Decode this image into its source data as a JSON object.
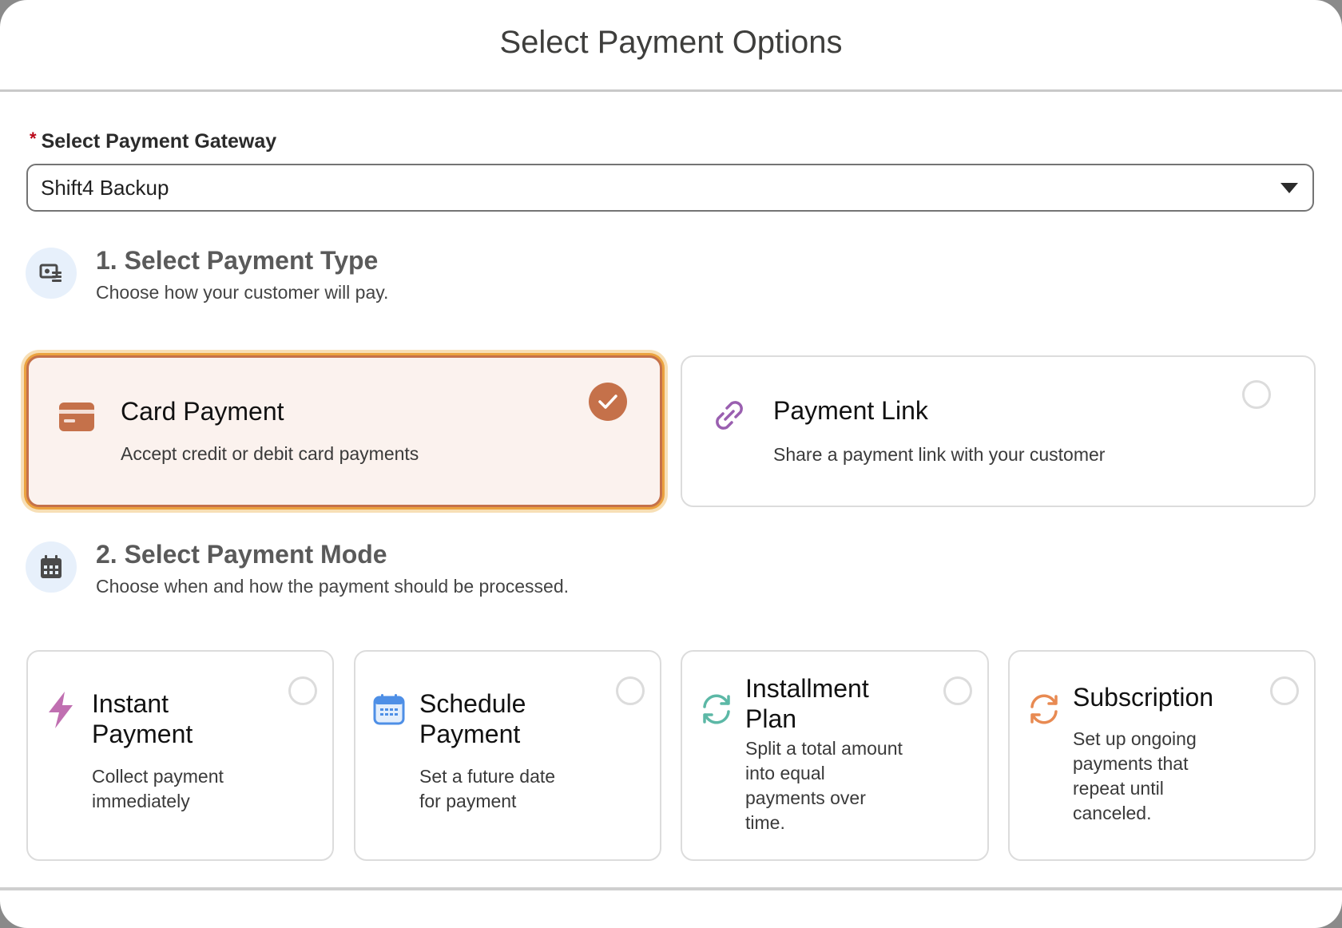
{
  "modal": {
    "title": "Select Payment Options"
  },
  "gateway": {
    "required_marker": "*",
    "label": "Select Payment Gateway",
    "selected_value": "Shift4 Backup"
  },
  "payment_type": {
    "title": "1. Select Payment Type",
    "subtitle": "Choose how your customer will pay.",
    "icon": "cash-register-icon",
    "options": [
      {
        "title": "Card Payment",
        "description": "Accept credit or debit card payments",
        "icon": "credit-card-icon",
        "selected": true
      },
      {
        "title": "Payment Link",
        "description": "Share a payment link with your customer",
        "icon": "link-icon",
        "selected": false
      }
    ]
  },
  "payment_mode": {
    "title": "2. Select Payment Mode",
    "subtitle": "Choose when and how the payment should be processed.",
    "icon": "calendar-icon",
    "options": [
      {
        "title_line1": "Instant",
        "title_line2": "Payment",
        "desc_line1": "Collect payment",
        "desc_line2": "immediately",
        "icon": "lightning-icon",
        "selected": false
      },
      {
        "title_line1": "Schedule",
        "title_line2": "Payment",
        "desc_line1": "Set a future date",
        "desc_line2": "for payment",
        "icon": "calendar-icon",
        "selected": false
      },
      {
        "title_line1": "Installment",
        "title_line2": "Plan",
        "desc_line1": "Split a total amount",
        "desc_line2": "into equal",
        "desc_line3": "payments over",
        "desc_line4": "time.",
        "icon": "refresh-icon",
        "selected": false
      },
      {
        "title_line1": "Subscription",
        "desc_line1": "Set up ongoing",
        "desc_line2": "payments that",
        "desc_line3": "repeat until",
        "desc_line4": "canceled.",
        "icon": "refresh-icon",
        "selected": false
      }
    ]
  },
  "colors": {
    "accent": "#c5714a",
    "focus_ring": "#eba23f",
    "selected_bg": "#fbf2ee",
    "required": "#ba0517",
    "lightning": "#c06fb1",
    "calendar": "#4e8fe6",
    "installment": "#5cb8a6",
    "subscription": "#e88a52",
    "link": "#9a5fb0"
  }
}
